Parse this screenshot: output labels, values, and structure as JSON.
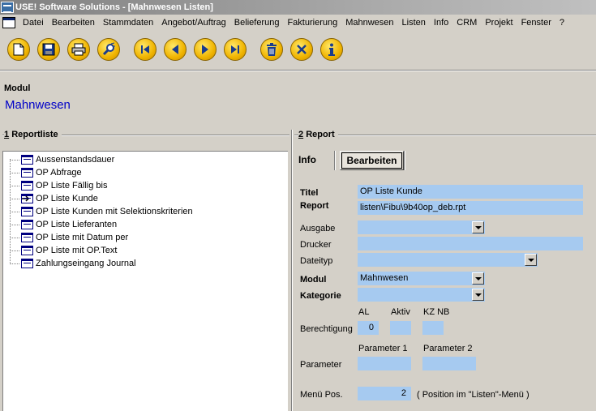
{
  "window": {
    "title": "USE! Software Solutions - [Mahnwesen Listen]"
  },
  "menu": [
    {
      "label": "Datei"
    },
    {
      "label": "Bearbeiten"
    },
    {
      "label": "Stammdaten"
    },
    {
      "label": "Angebot/Auftrag"
    },
    {
      "label": "Belieferung"
    },
    {
      "label": "Fakturierung"
    },
    {
      "label": "Mahnwesen"
    },
    {
      "label": "Listen"
    },
    {
      "label": "Info"
    },
    {
      "label": "CRM"
    },
    {
      "label": "Projekt"
    },
    {
      "label": "Fenster"
    },
    {
      "label": "?"
    }
  ],
  "toolbar": {
    "icons": [
      "new-icon",
      "save-icon",
      "print-icon",
      "search-icon",
      "first-icon",
      "prev-icon",
      "next-icon",
      "last-icon",
      "delete-icon",
      "cancel-icon",
      "info-icon"
    ]
  },
  "modul": {
    "label": "Modul",
    "value": "Mahnwesen"
  },
  "reportlist": {
    "number": "1",
    "title": "Reportliste",
    "items": [
      "Aussenstandsdauer",
      "OP Abfrage",
      "OP Liste Fällig bis",
      "OP Liste Kunde",
      "OP Liste Kunden mit Selektionskriterien",
      "OP Liste Lieferanten",
      "OP Liste mit Datum per",
      "OP Liste mit OP.Text",
      "Zahlungseingang Journal"
    ],
    "selected_index": 3
  },
  "report": {
    "number": "2",
    "title": "Report",
    "tabs": {
      "info": "Info",
      "bearbeiten": "Bearbeiten"
    },
    "fields": {
      "titel_label": "Titel",
      "titel_value": "OP Liste Kunde",
      "report_label": "Report",
      "report_value": "listen\\Fibu\\9b40op_deb.rpt",
      "ausgabe_label": "Ausgabe",
      "ausgabe_value": "",
      "drucker_label": "Drucker",
      "drucker_value": "",
      "dateityp_label": "Dateityp",
      "dateityp_value": "",
      "modul_label": "Modul",
      "modul_value": "Mahnwesen",
      "kategorie_label": "Kategorie",
      "kategorie_value": ""
    },
    "berechtigung": {
      "label": "Berechtigung",
      "al_label": "AL",
      "al_value": "0",
      "aktiv_label": "Aktiv",
      "aktiv_value": "",
      "kznb_label": "KZ NB",
      "kznb_value": ""
    },
    "parameter": {
      "label": "Parameter",
      "p1_label": "Parameter 1",
      "p1_value": "",
      "p2_label": "Parameter 2",
      "p2_value": ""
    },
    "menu_pos": {
      "label": "Menü Pos.",
      "value": "2",
      "hint": "( Position im \"Listen\"-Menü )"
    }
  },
  "colors": {
    "field_bg": "#a6caf0",
    "modul_blue": "#0000c8",
    "window_bg": "#d4d0c8"
  }
}
